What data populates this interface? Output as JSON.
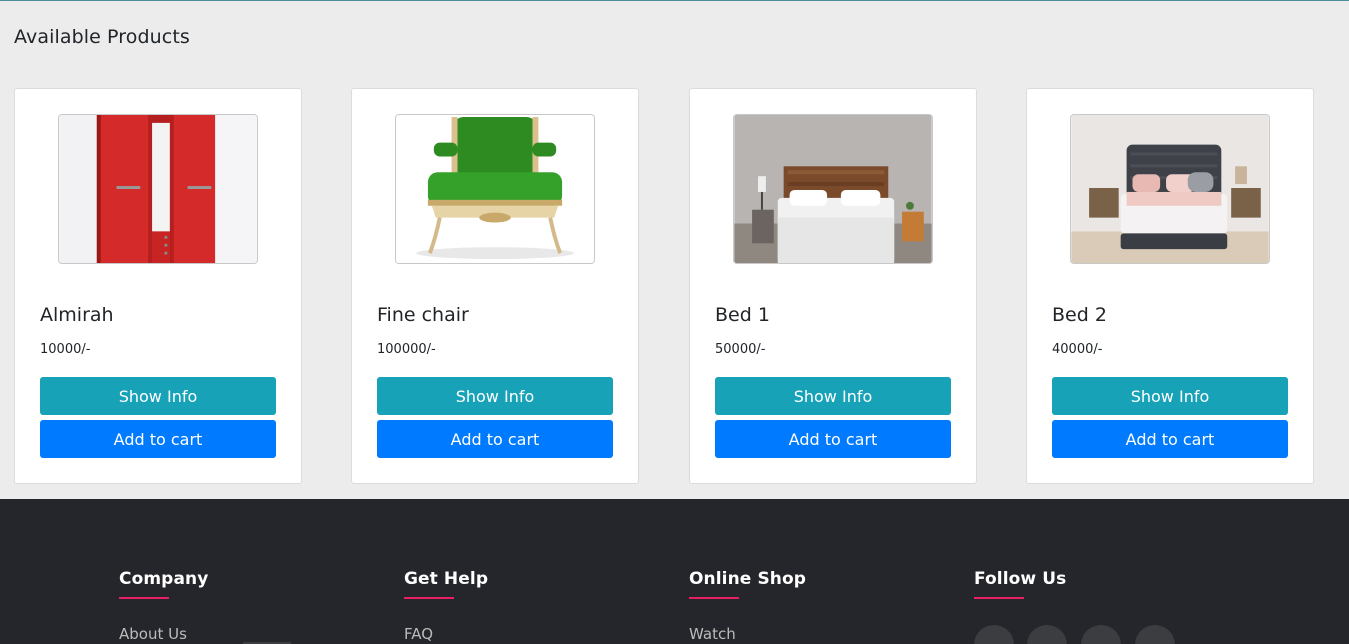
{
  "section_title": "Available Products",
  "products": [
    {
      "name": "Almirah",
      "price": "10000/-",
      "image_icon": "almirah-image"
    },
    {
      "name": "Fine chair",
      "price": "100000/-",
      "image_icon": "chair-image"
    },
    {
      "name": "Bed 1",
      "price": "50000/-",
      "image_icon": "bed-image"
    },
    {
      "name": "Bed 2",
      "price": "40000/-",
      "image_icon": "bed-image"
    }
  ],
  "buttons": {
    "show_info": "Show Info",
    "add_to_cart": "Add to cart"
  },
  "footer": {
    "columns": [
      {
        "title": "Company",
        "first_link": "About Us"
      },
      {
        "title": "Get Help",
        "first_link": "FAQ"
      },
      {
        "title": "Online Shop",
        "first_link": "Watch"
      },
      {
        "title": "Follow Us",
        "first_link": ""
      }
    ],
    "social_icons": [
      "social-icon",
      "social-icon",
      "social-icon",
      "social-icon"
    ]
  },
  "colors": {
    "page_bg": "#ececec",
    "show_info": "#17a2b8",
    "add_to_cart": "#007bff",
    "footer_bg": "#24262b",
    "footer_accent": "#e91e63"
  }
}
